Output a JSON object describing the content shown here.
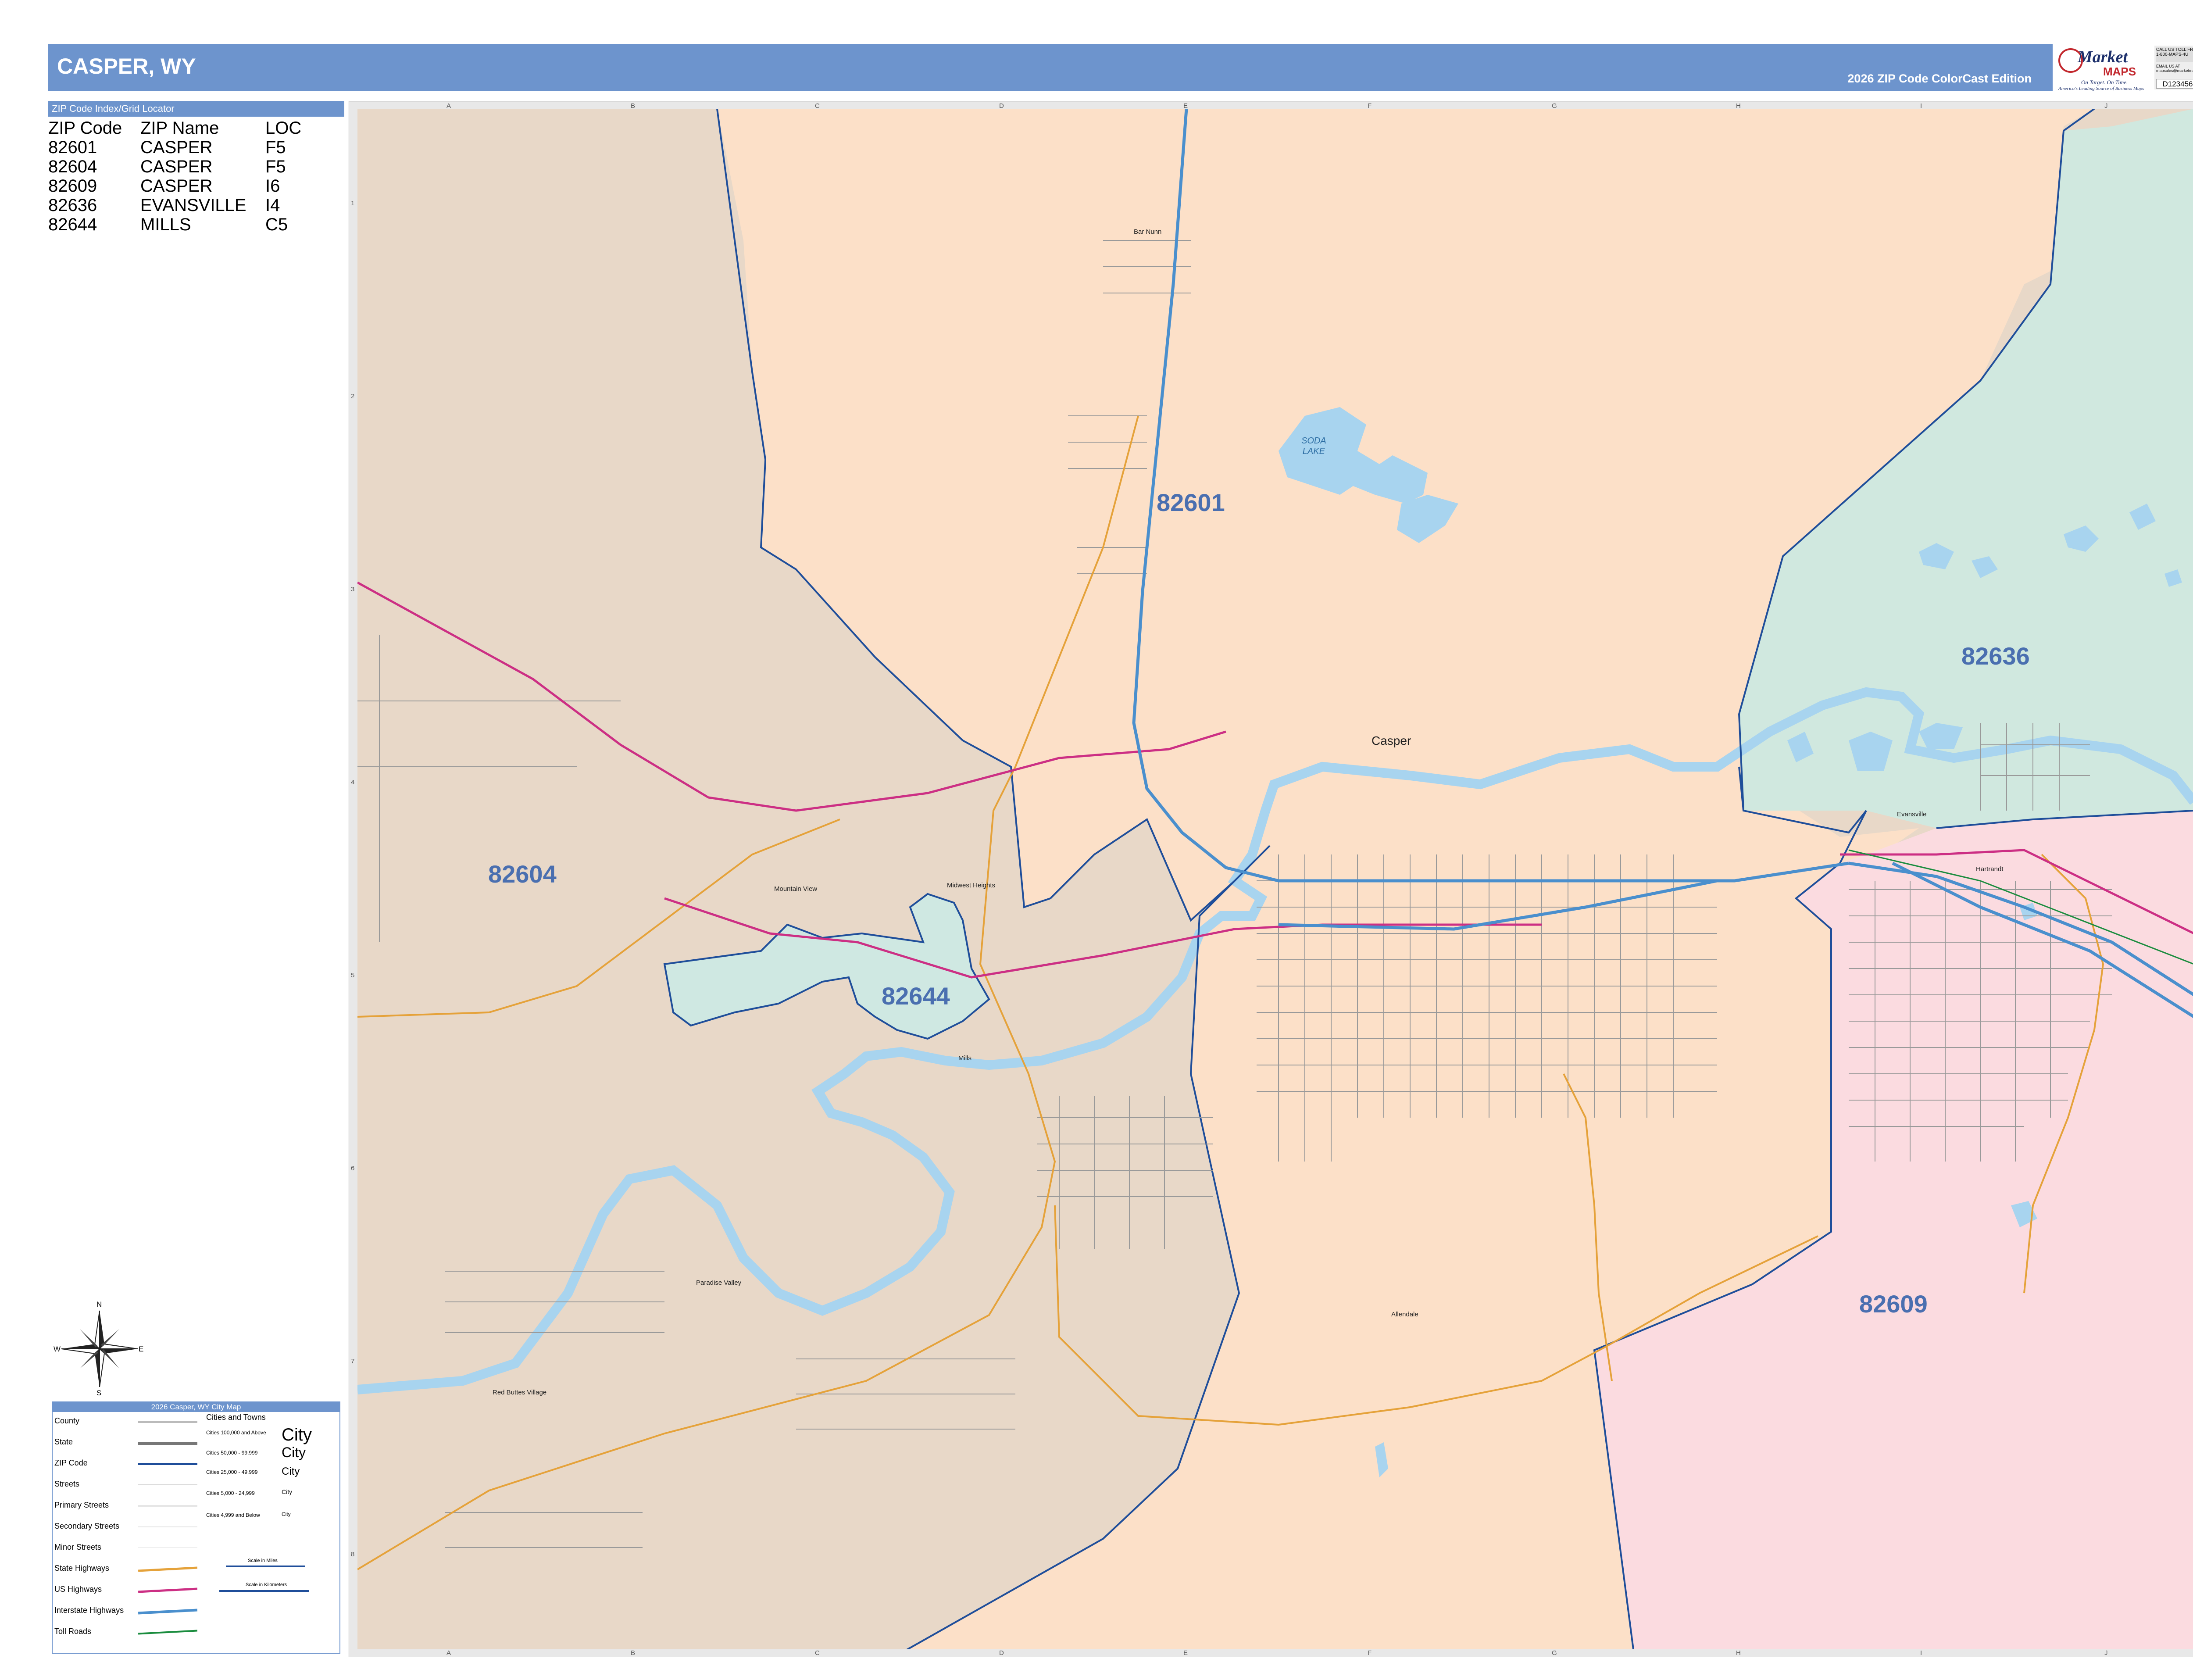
{
  "header": {
    "title": "CASPER, WY",
    "edition": "2026 ZIP Code ColorCast Edition"
  },
  "logo": {
    "brand": "Market",
    "maps": "MAPS",
    "tagline": "On Target. On Time.",
    "subtag": "America's Leading Source of Business Maps",
    "call": "CALL US TOLL FREE 1-800-MAPS-4U",
    "email": "EMAIL US AT mapsales@marketmaps.com",
    "code": "D123456"
  },
  "zip_index": {
    "title": "ZIP Code Index/Grid Locator",
    "columns": [
      "ZIP Code",
      "ZIP Name",
      "LOC"
    ],
    "rows": [
      [
        "82601",
        "CASPER",
        "F5"
      ],
      [
        "82604",
        "CASPER",
        "F5"
      ],
      [
        "82609",
        "CASPER",
        "I6"
      ],
      [
        "82636",
        "EVANSVILLE",
        "I4"
      ],
      [
        "82644",
        "MILLS",
        "C5"
      ]
    ]
  },
  "map": {
    "zip_labels": [
      {
        "id": "z82601",
        "text": "82601"
      },
      {
        "id": "z82604",
        "text": "82604"
      },
      {
        "id": "z82636",
        "text": "82636"
      },
      {
        "id": "z82644",
        "text": "82644"
      },
      {
        "id": "z82609",
        "text": "82609"
      }
    ],
    "zone_colors": {
      "82601": "#fce0c8",
      "82604": "#e8d8c8",
      "82636": "#d0e8df",
      "82644": "#cfe8e2",
      "82609": "#fbdbe0"
    },
    "water_color": "#a8d4ef",
    "water_labels": [
      "SODA",
      "LAKE"
    ],
    "places": [
      {
        "id": "casper",
        "text": "Casper"
      },
      {
        "id": "barnunn",
        "text": "Bar Nunn"
      },
      {
        "id": "evansville",
        "text": "Evansville"
      },
      {
        "id": "mountainview",
        "text": "Mountain View"
      },
      {
        "id": "mills",
        "text": "Mills"
      },
      {
        "id": "midwestheights",
        "text": "Midwest Heights"
      },
      {
        "id": "paradisevalley",
        "text": "Paradise Valley"
      },
      {
        "id": "allendale",
        "text": "Allendale"
      },
      {
        "id": "redbutteS",
        "text": "Red Buttes Village"
      },
      {
        "id": "hartrandt",
        "text": "Hartrandt"
      }
    ],
    "grid_columns": [
      "A",
      "B",
      "C",
      "D",
      "E",
      "F",
      "G",
      "H",
      "I",
      "J"
    ],
    "grid_rows": [
      "1",
      "2",
      "3",
      "4",
      "5",
      "6",
      "7",
      "8"
    ]
  },
  "compass": {
    "n": "N",
    "s": "S",
    "e": "E",
    "w": "W"
  },
  "legend": {
    "title": "2026 Casper, WY City Map",
    "items": [
      "County",
      "State",
      "ZIP Code",
      "Streets",
      "Primary Streets",
      "Secondary Streets",
      "Minor Streets",
      "State Highways",
      "US Highways",
      "Interstate Highways",
      "Toll Roads"
    ],
    "cities_title": "Cities and Towns",
    "cities": [
      {
        "label": "Cities 100,000 and Above",
        "example": "City"
      },
      {
        "label": "Cities 50,000 - 99,999",
        "example": "City"
      },
      {
        "label": "Cities 25,000 - 49,999",
        "example": "City"
      },
      {
        "label": "Cities 5,000 - 24,999",
        "example": "City"
      },
      {
        "label": "Cities 4,999 and Below",
        "example": "City"
      }
    ],
    "scale_miles": "Scale in Miles",
    "scale_km": "Scale in Kilometers"
  }
}
